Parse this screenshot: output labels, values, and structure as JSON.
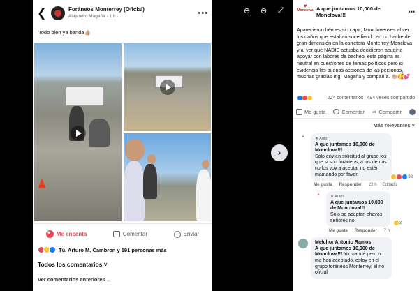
{
  "phone": {
    "group_name": "Foráneos Monterrey (Oficial)",
    "author_line": "Alejandro Magaña · 1 h ·",
    "caption": "Todo bien ya banda👍🏼",
    "actions": {
      "like": "Me encanta",
      "comment": "Comentar",
      "share": "Enviar"
    },
    "reactions_text": "Tú, Arturo M. Cambron y 191 personas más",
    "all_comments": "Todos los comentarios ˅",
    "previous_comments": "Ver comentarios anteriores..."
  },
  "viewer": {
    "next": "›"
  },
  "panel": {
    "logo_text": "Monclova",
    "page_title": "A que juntamos 10,000 de Monclova!!!",
    "body": "Aparecieron héroes sin capa, Monclovenses al ver los daños que estaban sucediendo en un bache de gran dimensión en la carretera Monterrey-Monclova y al ver que NADIE actuaba decidieron acudir a apoyar con labores de bacheo, esta página es neutral en cuestiones de temas políticos pero si evidencia las buenas acciones de las personas, muchas gracias Ing. Magaña y compañía. 👏🏼🥰💕",
    "comments_count": "224 comentarios",
    "shares_count": "494 veces compartido",
    "actions": {
      "like": "Me gusta",
      "comment": "Comentar",
      "share": "Compartir"
    },
    "sort_label": "Más relevantes ˅",
    "comments": [
      {
        "badge": "★ Autor",
        "name": "A que juntamos 10,000 de Monclova!!!",
        "text": "Solo envíen solicitud al grupo los que si son foráneos, a los demás no los voy a aceptar no estén mamando por favor.",
        "reactions": "98",
        "meta": {
          "like": "Me gusta",
          "reply": "Responder",
          "time": "22 h",
          "edited": "Editado"
        }
      },
      {
        "badge": "★ Autor",
        "name": "A que juntamos 10,000 de Monclova!!!",
        "text": "Solo se aceptan chavos, señores no.",
        "reactions": "3",
        "meta": {
          "like": "Me gusta",
          "reply": "Responder",
          "time": "7 h"
        }
      },
      {
        "name": "Melchor Antonio Ramos",
        "mention": "A que juntamos 10,000 de Monclova!!!",
        "text": "Yo mandé pero no me han aceptado, estoy en el grupo foráneos Monterrey, el no oficial"
      }
    ]
  }
}
